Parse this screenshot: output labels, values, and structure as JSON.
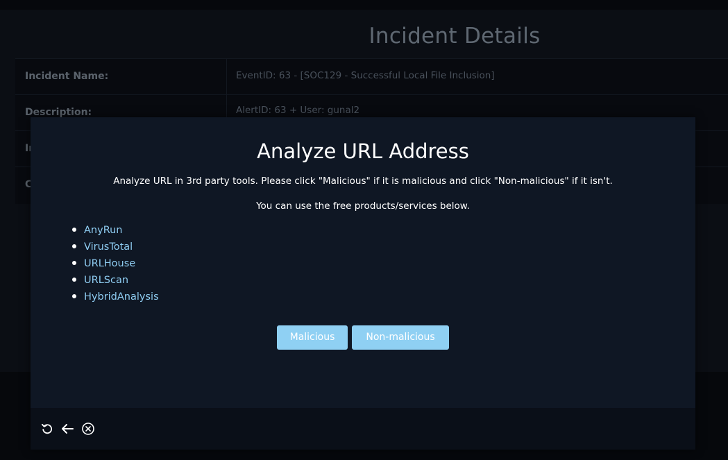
{
  "background": {
    "page_title": "Incident Details",
    "rows": [
      {
        "label": "Incident Name:",
        "value": "EventID: 63 - [SOC129 - Successful Local File Inclusion]"
      },
      {
        "label": "Description:",
        "value": "AlertID: 63 + User: gunal2"
      },
      {
        "label": "In",
        "value": ""
      },
      {
        "label": "C",
        "value": ""
      }
    ]
  },
  "modal": {
    "title": "Analyze URL Address",
    "instructions": "Analyze URL in 3rd party tools. Please click \"Malicious\" if it is malicious and click \"Non-malicious\" if it isn't.",
    "subtitle": "You can use the free products/services below.",
    "tools": [
      {
        "label": "AnyRun"
      },
      {
        "label": "VirusTotal"
      },
      {
        "label": "URLHouse"
      },
      {
        "label": "URLScan"
      },
      {
        "label": "HybridAnalysis"
      }
    ],
    "buttons": {
      "malicious": "Malicious",
      "non_malicious": "Non-malicious"
    }
  },
  "footer": {
    "icons": [
      "restart-icon",
      "back-arrow-icon",
      "close-circle-icon"
    ]
  },
  "colors": {
    "accent_button": "#8fd0f3",
    "link": "#8fcdf2",
    "modal_bg": "#0f1724"
  }
}
